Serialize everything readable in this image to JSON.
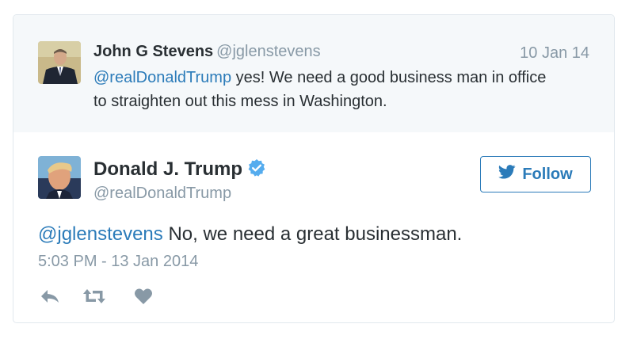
{
  "quoted_tweet": {
    "author_name": "John G Stevens",
    "author_handle": "@jglenstevens",
    "date": "10 Jan 14",
    "mention": "@realDonaldTrump",
    "text_line1_rest": " yes! We need a good business man in office",
    "text_line2": "to straighten out this mess in Washington.",
    "avatar_icon": "person-in-suit-avatar"
  },
  "main_tweet": {
    "author_name": "Donald J. Trump",
    "author_handle": "@realDonaldTrump",
    "verified_icon": "verified-badge-icon",
    "follow_label": "Follow",
    "follow_icon": "bird-icon",
    "mention": "@jglenstevens",
    "text_rest": " No, we need a great businessman.",
    "timestamp": "5:03 PM - 13 Jan 2014",
    "avatar_icon": "portrait-avatar"
  },
  "actions": {
    "reply_icon": "reply-icon",
    "retweet_icon": "retweet-icon",
    "like_icon": "heart-icon"
  },
  "colors": {
    "link": "#2b7bb9",
    "muted": "#8899a6",
    "text": "#292f33",
    "quoted_bg": "#f5f8fa",
    "verified": "#55acee"
  }
}
